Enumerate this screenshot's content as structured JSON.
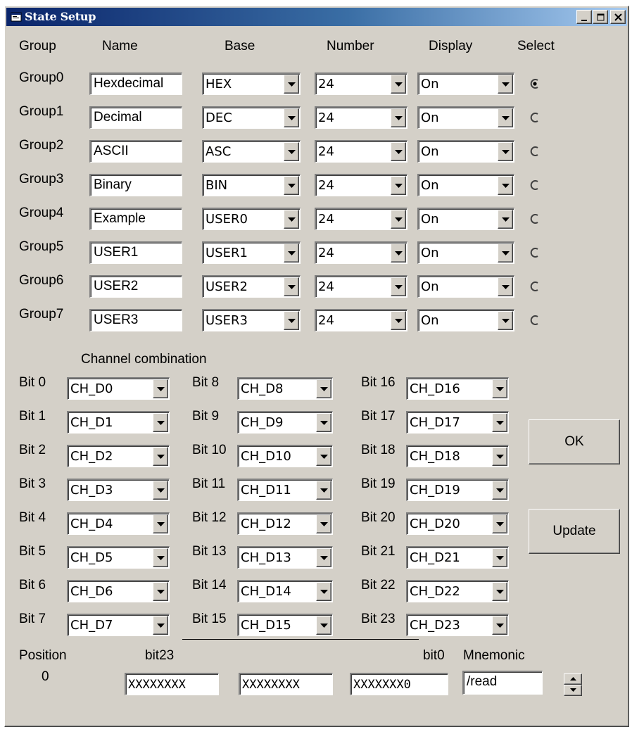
{
  "window": {
    "title": "State Setup",
    "icon": "app-window-icon",
    "buttons": {
      "minimize": "minimize-icon",
      "maximize": "maximize-icon",
      "close": "close-icon"
    }
  },
  "headers": {
    "group": "Group",
    "name": "Name",
    "base": "Base",
    "number": "Number",
    "display": "Display",
    "select": "Select"
  },
  "groups": [
    {
      "label": "Group0",
      "name": "Hexdecimal",
      "base": "HEX",
      "number": "24",
      "display": "On",
      "selected": true
    },
    {
      "label": "Group1",
      "name": "Decimal",
      "base": "DEC",
      "number": "24",
      "display": "On",
      "selected": false
    },
    {
      "label": "Group2",
      "name": "ASCII",
      "base": "ASC",
      "number": "24",
      "display": "On",
      "selected": false
    },
    {
      "label": "Group3",
      "name": "Binary",
      "base": "BIN",
      "number": "24",
      "display": "On",
      "selected": false
    },
    {
      "label": "Group4",
      "name": "Example",
      "base": "USER0",
      "number": "24",
      "display": "On",
      "selected": false
    },
    {
      "label": "Group5",
      "name": "USER1",
      "base": "USER1",
      "number": "24",
      "display": "On",
      "selected": false
    },
    {
      "label": "Group6",
      "name": "USER2",
      "base": "USER2",
      "number": "24",
      "display": "On",
      "selected": false
    },
    {
      "label": "Group7",
      "name": "USER3",
      "base": "USER3",
      "number": "24",
      "display": "On",
      "selected": false
    }
  ],
  "channel_section_label": "Channel combination",
  "bits": [
    {
      "label": "Bit 0",
      "value": "CH_D0"
    },
    {
      "label": "Bit 1",
      "value": "CH_D1"
    },
    {
      "label": "Bit 2",
      "value": "CH_D2"
    },
    {
      "label": "Bit 3",
      "value": "CH_D3"
    },
    {
      "label": "Bit 4",
      "value": "CH_D4"
    },
    {
      "label": "Bit 5",
      "value": "CH_D5"
    },
    {
      "label": "Bit 6",
      "value": "CH_D6"
    },
    {
      "label": "Bit 7",
      "value": "CH_D7"
    },
    {
      "label": "Bit 8",
      "value": "CH_D8"
    },
    {
      "label": "Bit 9",
      "value": "CH_D9"
    },
    {
      "label": "Bit 10",
      "value": "CH_D10"
    },
    {
      "label": "Bit 11",
      "value": "CH_D11"
    },
    {
      "label": "Bit 12",
      "value": "CH_D12"
    },
    {
      "label": "Bit 13",
      "value": "CH_D13"
    },
    {
      "label": "Bit 14",
      "value": "CH_D14"
    },
    {
      "label": "Bit 15",
      "value": "CH_D15"
    },
    {
      "label": "Bit 16",
      "value": "CH_D16"
    },
    {
      "label": "Bit 17",
      "value": "CH_D17"
    },
    {
      "label": "Bit 18",
      "value": "CH_D18"
    },
    {
      "label": "Bit 19",
      "value": "CH_D19"
    },
    {
      "label": "Bit 20",
      "value": "CH_D20"
    },
    {
      "label": "Bit 21",
      "value": "CH_D21"
    },
    {
      "label": "Bit 22",
      "value": "CH_D22"
    },
    {
      "label": "Bit 23",
      "value": "CH_D23"
    }
  ],
  "buttons": {
    "ok": "OK",
    "update": "Update"
  },
  "footer": {
    "position_label": "Position",
    "position_value": "0",
    "bit_high_label": "bit23",
    "bit_low_label": "bit0",
    "mnemonic_label": "Mnemonic",
    "pattern_fields": [
      "XXXXXXXX",
      "XXXXXXXX",
      "XXXXXXX0"
    ],
    "mnemonic_value": "/read"
  }
}
